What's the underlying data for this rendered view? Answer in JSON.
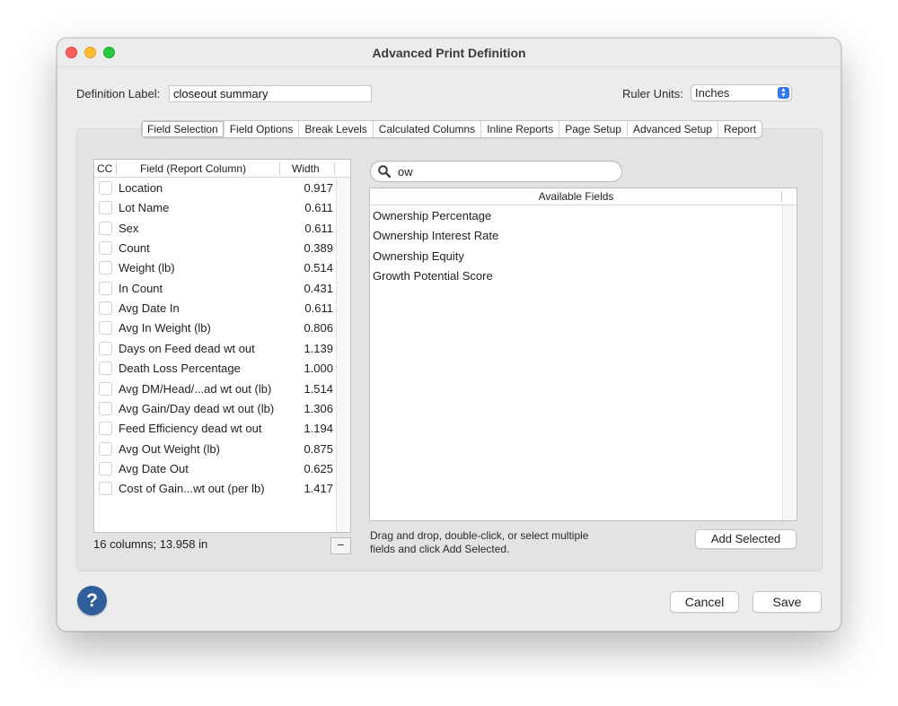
{
  "window": {
    "title": "Advanced Print Definition"
  },
  "definition": {
    "label": "Definition Label:",
    "value": "closeout summary"
  },
  "ruler": {
    "label": "Ruler Units:",
    "value": "Inches"
  },
  "tabs": [
    {
      "label": "Field Selection",
      "active": true
    },
    {
      "label": "Field Options"
    },
    {
      "label": "Break Levels"
    },
    {
      "label": "Calculated Columns"
    },
    {
      "label": "Inline Reports"
    },
    {
      "label": "Page Setup"
    },
    {
      "label": "Advanced Setup"
    },
    {
      "label": "Report"
    }
  ],
  "field_list": {
    "headers": {
      "cc": "CC",
      "field": "Field (Report Column)",
      "width": "Width"
    },
    "rows": [
      {
        "name": "Location",
        "width": "0.917"
      },
      {
        "name": "Lot Name",
        "width": "0.611"
      },
      {
        "name": "Sex",
        "width": "0.611"
      },
      {
        "name": "Count",
        "width": "0.389"
      },
      {
        "name": "Weight (lb)",
        "width": "0.514"
      },
      {
        "name": "In Count",
        "width": "0.431"
      },
      {
        "name": "Avg Date In",
        "width": "0.611"
      },
      {
        "name": "Avg In Weight (lb)",
        "width": "0.806"
      },
      {
        "name": "Days on Feed dead wt out",
        "width": "1.139"
      },
      {
        "name": "Death Loss Percentage",
        "width": "1.000"
      },
      {
        "name": "Avg DM/Head/...ad wt out (lb)",
        "width": "1.514"
      },
      {
        "name": "Avg Gain/Day dead wt out (lb)",
        "width": "1.306"
      },
      {
        "name": "Feed Efficiency dead wt out",
        "width": "1.194"
      },
      {
        "name": "Avg Out Weight (lb)",
        "width": "0.875"
      },
      {
        "name": "Avg Date Out",
        "width": "0.625"
      },
      {
        "name": "Cost of Gain...wt out (per lb)",
        "width": "1.417"
      }
    ],
    "summary": "16 columns; 13.958 in",
    "remove_label": "−"
  },
  "search": {
    "value": "ow",
    "icon": "search-icon"
  },
  "available": {
    "header": "Available Fields",
    "rows": [
      "Ownership Percentage",
      "Ownership Interest Rate",
      "Ownership Equity",
      "Growth Potential Score"
    ],
    "hint": "Drag and drop, double-click, or select multiple fields and click Add Selected.",
    "add_label": "Add Selected"
  },
  "buttons": {
    "help": "?",
    "cancel": "Cancel",
    "save": "Save"
  },
  "colors": {
    "help": "#2f5e9b",
    "accent": "#3478f6",
    "close": "#fe5f57",
    "minimize": "#febc2e",
    "maximize": "#28c840"
  }
}
